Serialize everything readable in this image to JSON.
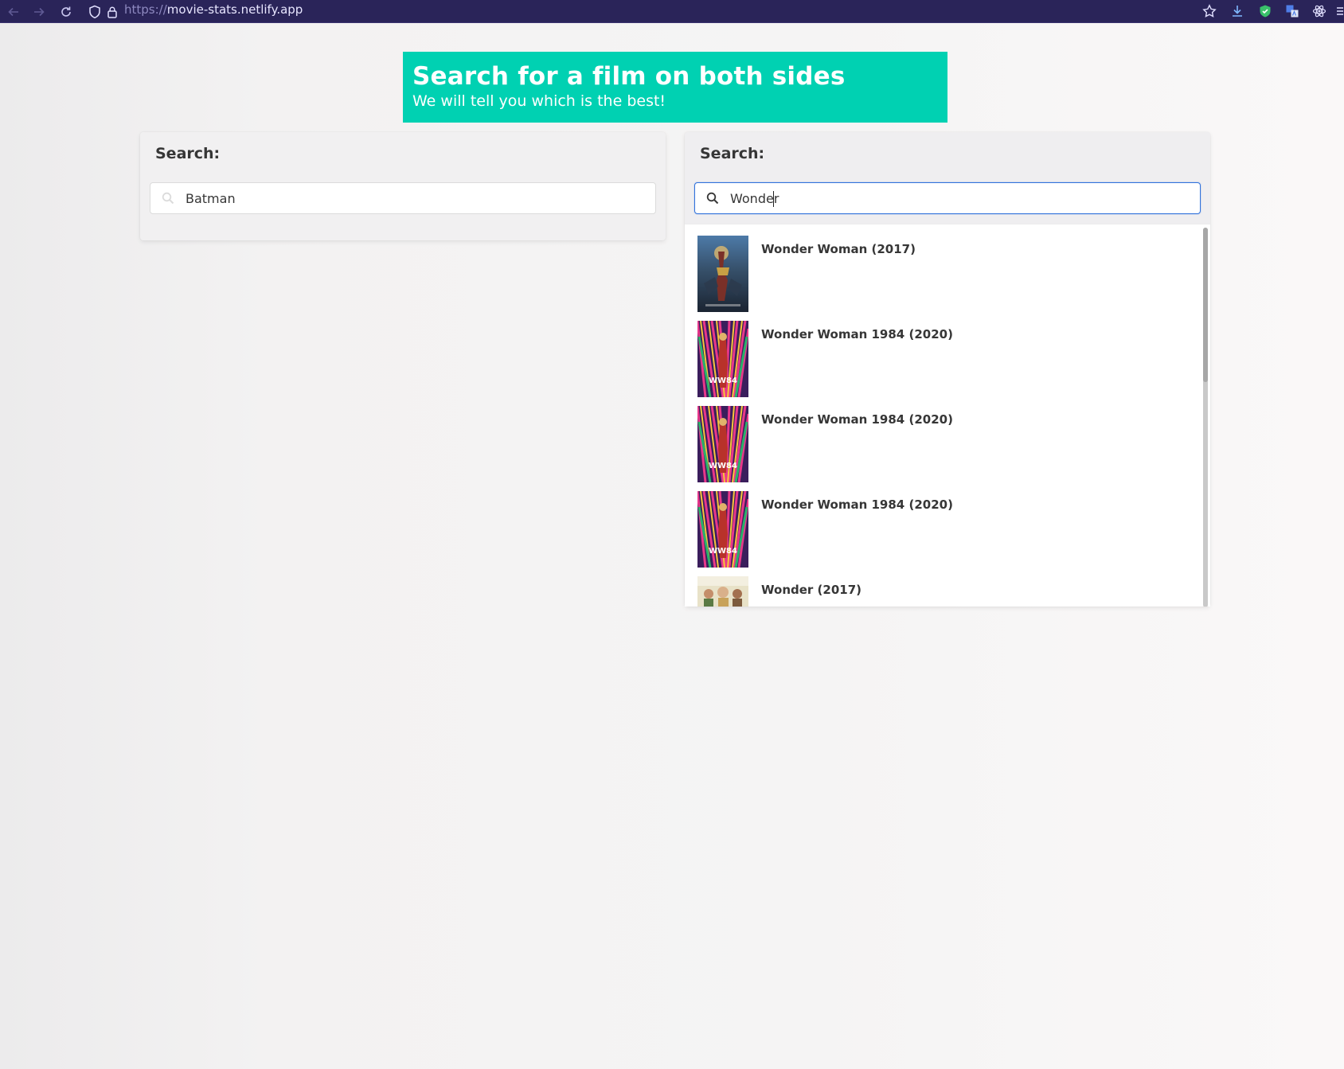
{
  "browser": {
    "url_scheme": "https://",
    "url_host": "movie-stats.netlify.app"
  },
  "banner": {
    "title": "Search for a film on both sides",
    "subtitle": "We will tell you which is the best!",
    "color": "#00d1b2"
  },
  "left_panel": {
    "label": "Search:",
    "input_value": "Batman"
  },
  "right_panel": {
    "label": "Search:",
    "input_value": "Wonder",
    "results": [
      {
        "title": "Wonder Woman (2017)",
        "poster": "wonder-woman-poster"
      },
      {
        "title": "Wonder Woman 1984 (2020)",
        "poster": "ww84-poster"
      },
      {
        "title": "Wonder Woman 1984 (2020)",
        "poster": "ww84-poster"
      },
      {
        "title": "Wonder Woman 1984 (2020)",
        "poster": "ww84-poster"
      },
      {
        "title": "Wonder (2017)",
        "poster": "wonder-poster"
      }
    ]
  },
  "poster_text": {
    "ww84": "WW84"
  }
}
